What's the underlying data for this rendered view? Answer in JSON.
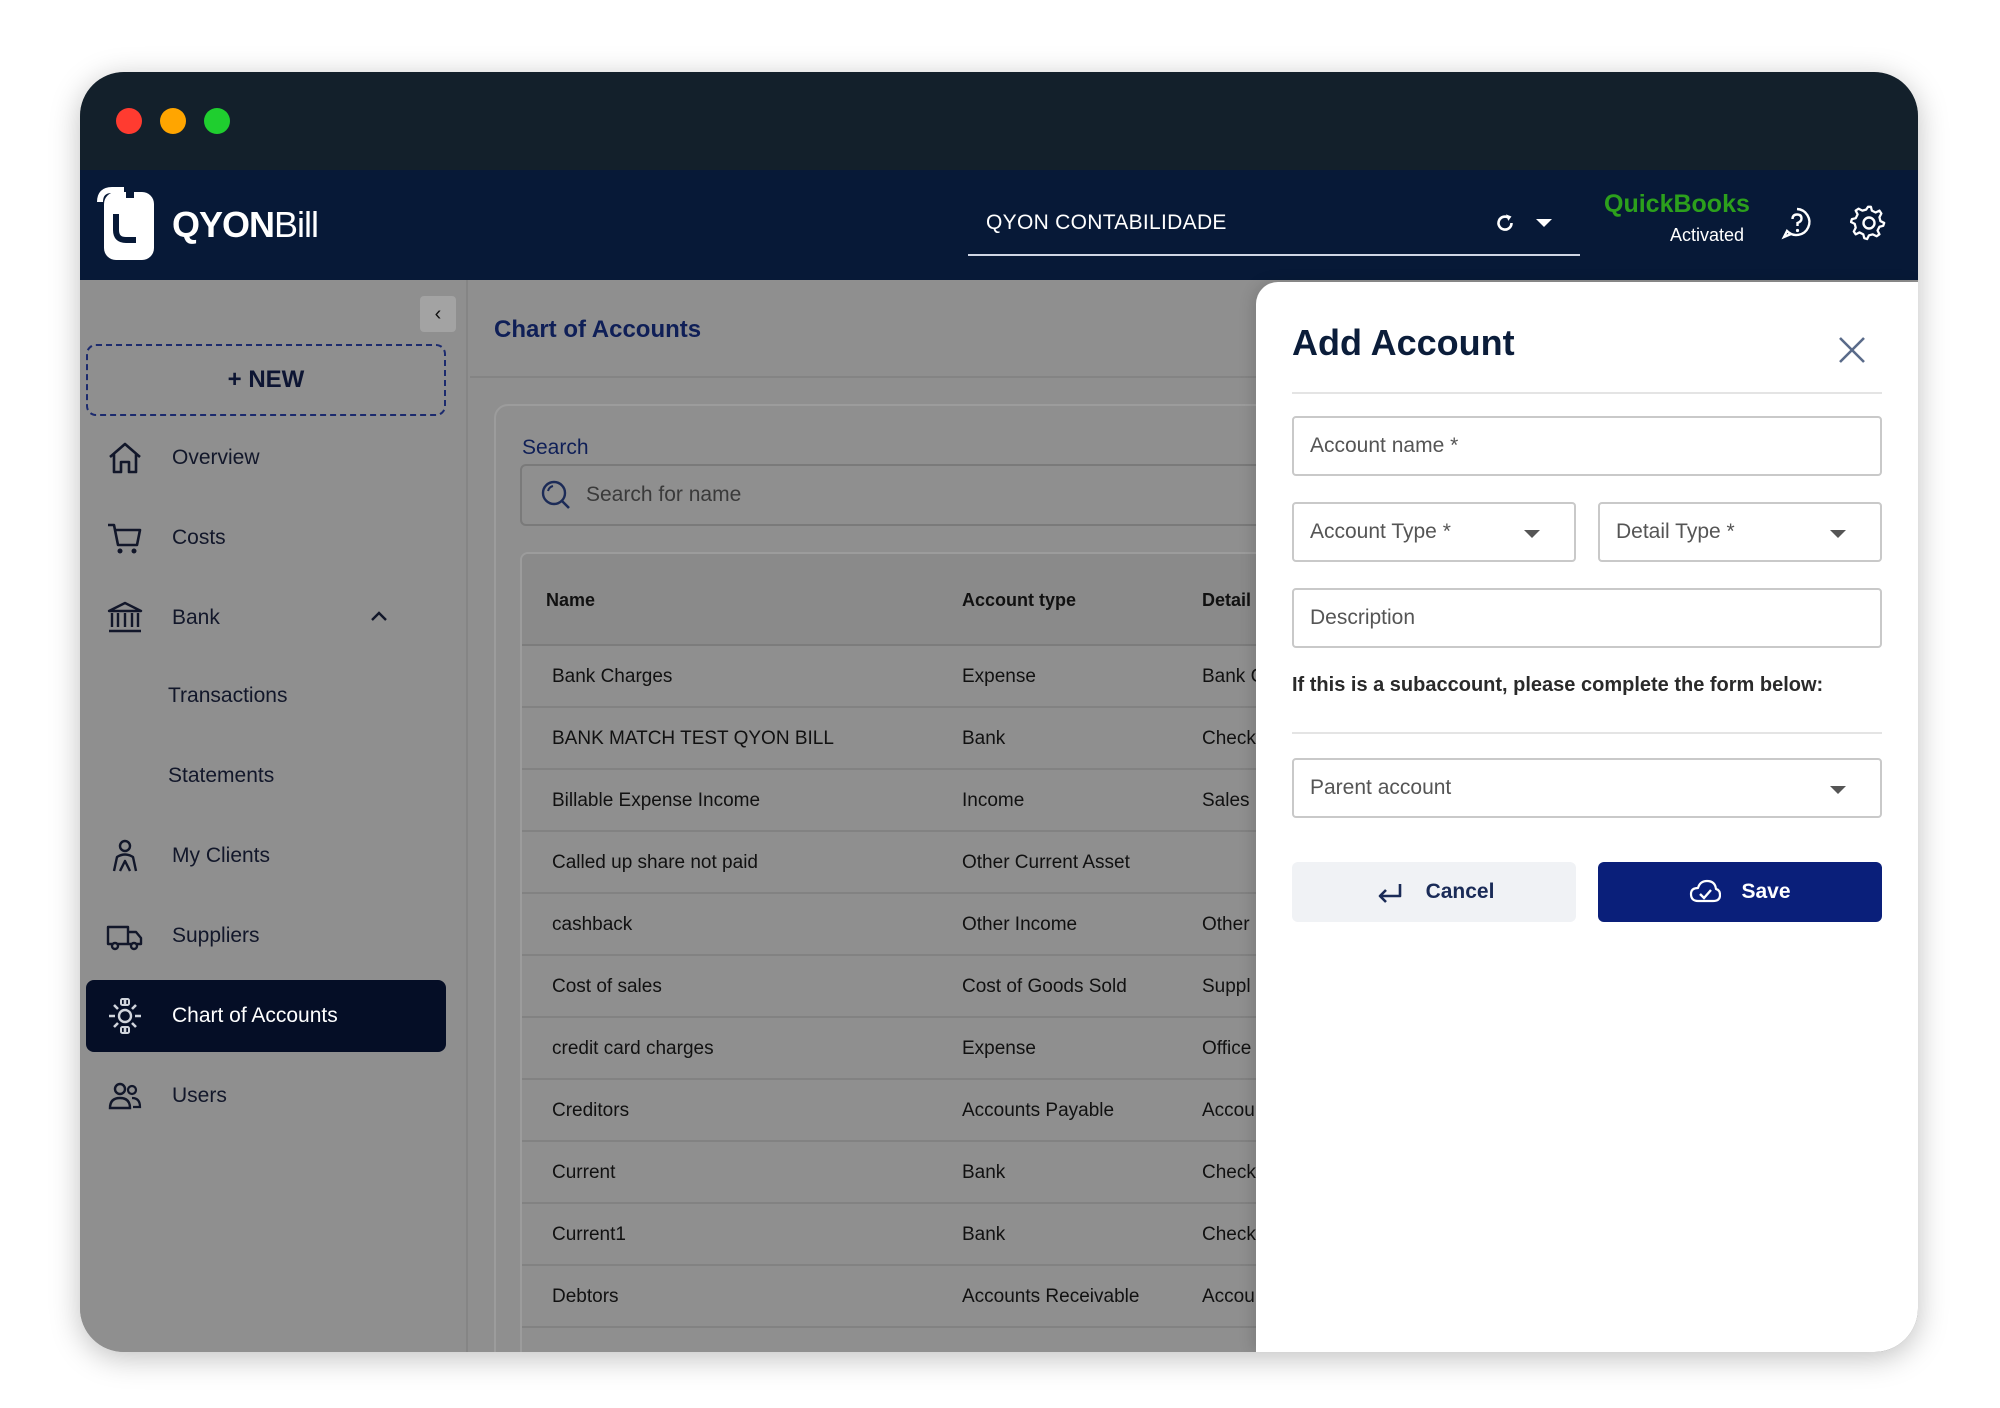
{
  "app": {
    "logo_brand": "QYON",
    "logo_product": "Bill",
    "company": "QYON CONTABILIDADE",
    "integration_name": "QuickBooks",
    "integration_status": "Activated",
    "colors": {
      "appbar": "#071937",
      "accent": "#0a1f7a",
      "quickbooks_green": "#2ca01c"
    }
  },
  "sidebar": {
    "new_label": "+ NEW",
    "collapse_icon": "chevron-left-icon",
    "items": [
      {
        "label": "Overview",
        "icon": "home-icon"
      },
      {
        "label": "Costs",
        "icon": "cart-icon"
      },
      {
        "label": "Bank",
        "icon": "bank-icon",
        "expanded": true
      },
      {
        "label": "Transactions"
      },
      {
        "label": "Statements"
      },
      {
        "label": "My Clients",
        "icon": "person-icon"
      },
      {
        "label": "Suppliers",
        "icon": "truck-icon"
      },
      {
        "label": "Chart of Accounts",
        "icon": "cog-network-icon",
        "active": true
      },
      {
        "label": "Users",
        "icon": "users-icon"
      }
    ]
  },
  "main": {
    "title": "Chart of Accounts",
    "search_label": "Search",
    "search_placeholder": "Search for name",
    "table": {
      "headers": [
        "Name",
        "Account type",
        "Detail"
      ],
      "rows": [
        [
          "Bank Charges",
          "Expense",
          "Bank C"
        ],
        [
          "BANK MATCH TEST QYON BILL",
          "Bank",
          "Check"
        ],
        [
          "Billable Expense Income",
          "Income",
          "Sales"
        ],
        [
          "Called up share not paid",
          "Other Current Asset",
          ""
        ],
        [
          "cashback",
          "Other Income",
          "Other"
        ],
        [
          "Cost of sales",
          "Cost of Goods Sold",
          "Suppl"
        ],
        [
          "credit card charges",
          "Expense",
          "Office"
        ],
        [
          "Creditors",
          "Accounts Payable",
          "Accou"
        ],
        [
          "Current",
          "Bank",
          "Check"
        ],
        [
          "Current1",
          "Bank",
          "Check"
        ],
        [
          "Debtors",
          "Accounts Receivable",
          "Accou"
        ]
      ]
    }
  },
  "panel": {
    "title": "Add Account",
    "account_name_placeholder": "Account name *",
    "account_type_placeholder": "Account Type *",
    "detail_type_placeholder": "Detail Type *",
    "description_placeholder": "Description",
    "subaccount_note": "If this is a subaccount, please complete the form below:",
    "parent_account_placeholder": "Parent account",
    "cancel_label": "Cancel",
    "save_label": "Save"
  }
}
